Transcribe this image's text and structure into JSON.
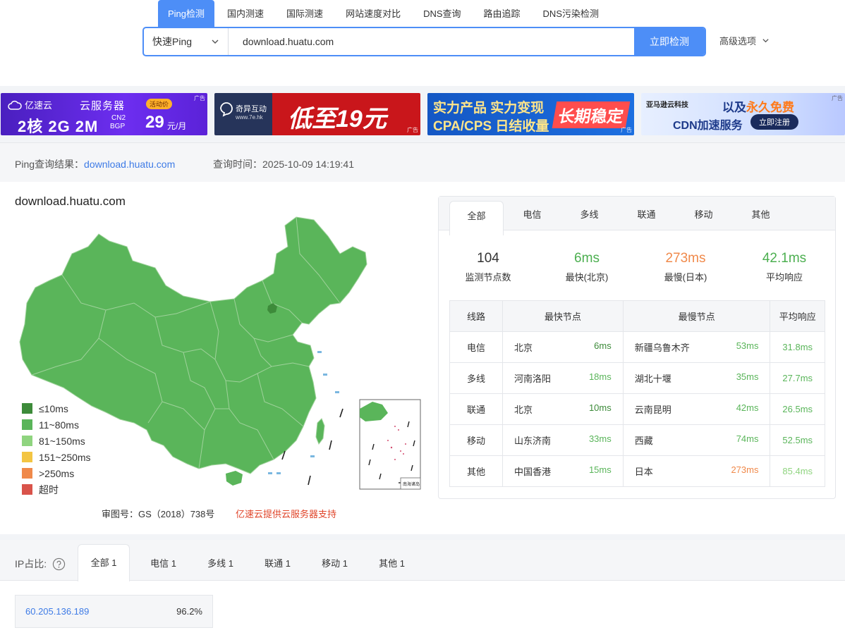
{
  "nav": {
    "items": [
      "Ping检测",
      "国内测速",
      "国际测速",
      "网站速度对比",
      "DNS查询",
      "路由追踪",
      "DNS污染检测"
    ]
  },
  "search": {
    "mode": "快速Ping",
    "value": "download.huatu.com",
    "button": "立即检测",
    "advanced": "高级选项"
  },
  "ads": [
    {
      "brand": "亿速云",
      "title": "云服务器",
      "spec": "2核 2G 2M",
      "extra1": "CN2",
      "extra2": "BGP",
      "badge": "活动价",
      "price": "29",
      "unit": "元/月",
      "tag": "广告"
    },
    {
      "brand": "奇异互动",
      "sub": "www.7e.hk",
      "text": "低至19元",
      "tag": "广告"
    },
    {
      "line1": "实力产品 实力变现",
      "line2": "CPA/CPS 日结收量",
      "highlight": "长期稳定",
      "tag": "广告"
    },
    {
      "brand": "亚马逊云科技",
      "line1a": "以及",
      "line1b": "永久免费",
      "line2": "CDN加速服务",
      "btn": "立即注册",
      "tag": "广告"
    }
  ],
  "result": {
    "label": "Ping查询结果：",
    "host": "download.huatu.com",
    "time_label": "查询时间：",
    "time": "2025-10-09 14:19:41"
  },
  "map": {
    "title": "download.huatu.com",
    "legend": [
      {
        "label": "≤10ms",
        "color": "#3d8b3a"
      },
      {
        "label": "11~80ms",
        "color": "#5ab55a"
      },
      {
        "label": "81~150ms",
        "color": "#8fd47f"
      },
      {
        "label": "151~250ms",
        "color": "#f3c543"
      },
      {
        "label": ">250ms",
        "color": "#f0894a"
      },
      {
        "label": "超时",
        "color": "#d9534a"
      }
    ],
    "approval": "审图号：GS（2018）738号",
    "sponsor": "亿速云提供云服务器支持",
    "inset_label": "南海诸岛"
  },
  "stats": {
    "tabs": [
      "全部",
      "电信",
      "多线",
      "联通",
      "移动",
      "其他"
    ],
    "summary": [
      {
        "value": "104",
        "label": "监测节点数",
        "color": "#333333"
      },
      {
        "value": "6ms",
        "label": "最快(北京)",
        "color": "#4caf50"
      },
      {
        "value": "273ms",
        "label": "最慢(日本)",
        "color": "#f0894a"
      },
      {
        "value": "42.1ms",
        "label": "平均响应",
        "color": "#4caf50"
      }
    ],
    "headers": [
      "线路",
      "最快节点",
      "最慢节点",
      "平均响应"
    ],
    "rows": [
      {
        "line": "电信",
        "fast_node": "北京",
        "fast_ms": "6ms",
        "slow_node": "新疆乌鲁木齐",
        "slow_ms": "53ms",
        "avg": "31.8ms"
      },
      {
        "line": "多线",
        "fast_node": "河南洛阳",
        "fast_ms": "18ms",
        "slow_node": "湖北十堰",
        "slow_ms": "35ms",
        "avg": "27.7ms"
      },
      {
        "line": "联通",
        "fast_node": "北京",
        "fast_ms": "10ms",
        "slow_node": "云南昆明",
        "slow_ms": "42ms",
        "avg": "26.5ms"
      },
      {
        "line": "移动",
        "fast_node": "山东济南",
        "fast_ms": "33ms",
        "slow_node": "西藏",
        "slow_ms": "74ms",
        "avg": "52.5ms"
      },
      {
        "line": "其他",
        "fast_node": "中国香港",
        "fast_ms": "15ms",
        "slow_node": "日本",
        "slow_ms": "273ms",
        "avg": "85.4ms"
      }
    ]
  },
  "ip": {
    "label": "IP占比:",
    "tabs": [
      "全部 1",
      "电信 1",
      "多线 1",
      "联通 1",
      "移动 1",
      "其他 1"
    ],
    "rows": [
      {
        "ip": "60.205.136.189",
        "pct": "96.2%"
      }
    ]
  },
  "colors": {
    "accent": "#4d8ef7",
    "fast_green": "#3d8b3a",
    "green": "#5ab55a",
    "orange": "#f0894a"
  }
}
